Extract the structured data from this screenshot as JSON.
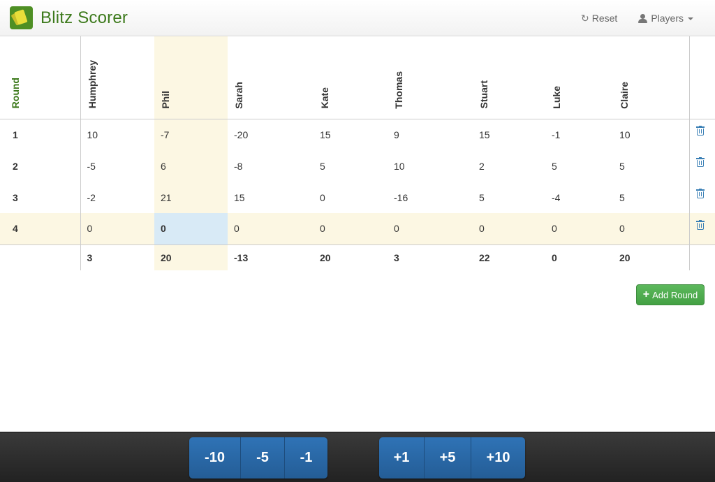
{
  "app": {
    "title": "Blitz Scorer",
    "accent": "#3d7a1c"
  },
  "nav": {
    "reset_label": "Reset",
    "players_label": "Players"
  },
  "table": {
    "round_header": "Round",
    "players": [
      "Humphrey",
      "Phil",
      "Sarah",
      "Kate",
      "Thomas",
      "Stuart",
      "Luke",
      "Claire"
    ],
    "highlighted_player": "Phil",
    "rounds": [
      {
        "round": "1",
        "scores": [
          "10",
          "-7",
          "-20",
          "15",
          "9",
          "15",
          "-1",
          "10"
        ]
      },
      {
        "round": "2",
        "scores": [
          "-5",
          "6",
          "-8",
          "5",
          "10",
          "2",
          "5",
          "5"
        ]
      },
      {
        "round": "3",
        "scores": [
          "-2",
          "21",
          "15",
          "0",
          "-16",
          "5",
          "-4",
          "5"
        ]
      },
      {
        "round": "4",
        "scores": [
          "0",
          "0",
          "0",
          "0",
          "0",
          "0",
          "0",
          "0"
        ]
      }
    ],
    "active_round": "4",
    "totals": [
      "3",
      "20",
      "-13",
      "20",
      "3",
      "22",
      "0",
      "20"
    ]
  },
  "add_round_label": "Add Round",
  "footer": {
    "minus_buttons": [
      "-10",
      "-5",
      "-1"
    ],
    "plus_buttons": [
      "+1",
      "+5",
      "+10"
    ]
  }
}
